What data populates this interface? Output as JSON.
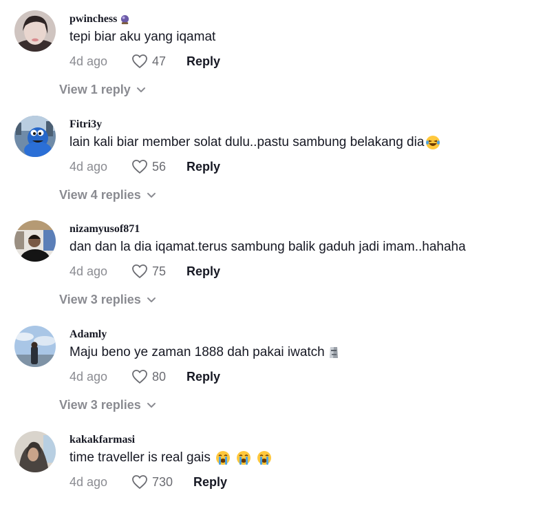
{
  "comments": [
    {
      "username": "pwinchess",
      "badge_icon": "crystal-ball-icon",
      "text": "tepi biar aku yang iqamat",
      "date": "4d ago",
      "likes": "47",
      "reply_label": "Reply",
      "view_replies": "View 1 reply"
    },
    {
      "username": "Fitri3y",
      "text": "lain kali biar member solat dulu..pastu sambung belakang dia",
      "text_emoji": "laughing-tears-emoji",
      "date": "4d ago",
      "likes": "56",
      "reply_label": "Reply",
      "view_replies": "View 4 replies"
    },
    {
      "username": "nizamyusof871",
      "text": "dan dan la dia iqamat.terus sambung balik gaduh jadi imam..hahaha",
      "date": "4d ago",
      "likes": "75",
      "reply_label": "Reply",
      "view_replies": "View 3 replies"
    },
    {
      "username": "Adamly",
      "text": "Maju beno ye zaman 1888 dah pakai iwatch",
      "text_emoji": "moai-emoji",
      "date": "4d ago",
      "likes": "80",
      "reply_label": "Reply",
      "view_replies": "View 3 replies"
    },
    {
      "username": "kakakfarmasi",
      "text": "time traveller is real gais",
      "text_emoji": "loudly-crying-emoji",
      "date": "4d ago",
      "likes": "730",
      "reply_label": "Reply"
    }
  ],
  "colors": {
    "text": "#161823",
    "muted": "#8a8b91"
  }
}
